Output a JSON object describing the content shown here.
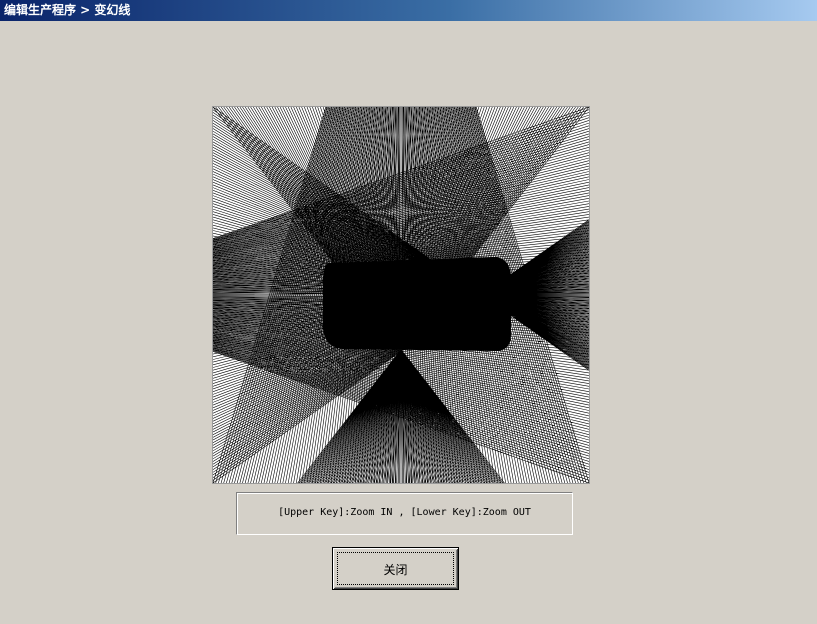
{
  "window": {
    "title": "编辑生产程序 > 变幻线"
  },
  "canvas": {
    "name": "moire-line-pattern",
    "background": "#ffffff",
    "line_color": "#000000"
  },
  "hint": {
    "text": "[Upper Key]:Zoom IN , [Lower Key]:Zoom OUT"
  },
  "buttons": {
    "close_label": "关闭"
  },
  "colors": {
    "window_bg": "#d4d0c8",
    "title_start": "#0a246a",
    "title_end": "#a6caf0"
  }
}
